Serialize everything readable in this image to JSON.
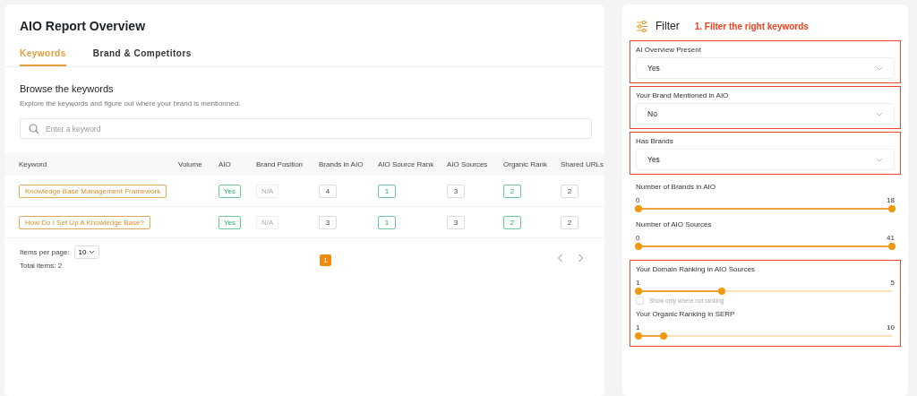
{
  "report": {
    "title": "AIO Report Overview",
    "tabs": [
      {
        "label": "Keywords",
        "selected": true
      },
      {
        "label": "Brand & Competitors",
        "selected": false
      }
    ],
    "section_title": "Browse the keywords",
    "section_description": "Explore the keywords and figure out where your brand is mentionned.",
    "search": {
      "placeholder": "Enter a keyword"
    },
    "table": {
      "columns": [
        "Keyword",
        "Volume",
        "AIO",
        "Brand Position",
        "Brands in AIO",
        "AIO Source Rank",
        "AIO Sources",
        "Organic Rank",
        "Shared URLs"
      ],
      "rows": [
        {
          "cells": [
            {
              "text": "Knowledge Base Management Framework",
              "kind": "keyword"
            },
            {
              "text": "",
              "kind": "empty"
            },
            {
              "text": "Yes",
              "kind": "positive"
            },
            {
              "text": "N/A",
              "kind": "muted"
            },
            {
              "text": "4",
              "kind": "neutral"
            },
            {
              "text": "1",
              "kind": "positive"
            },
            {
              "text": "3",
              "kind": "neutral"
            },
            {
              "text": "2",
              "kind": "positive"
            },
            {
              "text": "2",
              "kind": "neutral"
            }
          ]
        },
        {
          "cells": [
            {
              "text": "How Do I Set Up A Knowledge Base?",
              "kind": "keyword"
            },
            {
              "text": "",
              "kind": "empty"
            },
            {
              "text": "Yes",
              "kind": "positive"
            },
            {
              "text": "N/A",
              "kind": "muted"
            },
            {
              "text": "3",
              "kind": "neutral"
            },
            {
              "text": "1",
              "kind": "positive"
            },
            {
              "text": "3",
              "kind": "neutral"
            },
            {
              "text": "2",
              "kind": "positive"
            },
            {
              "text": "2",
              "kind": "neutral"
            }
          ]
        }
      ]
    },
    "pagination": {
      "items_per_page_label": "Items per page:",
      "items_per_page": "10",
      "total": "Total items: 2",
      "pages": [
        {
          "label": "1",
          "selected": true
        }
      ]
    }
  },
  "filter": {
    "title": "Filter",
    "annotation": "1. Filter the right keywords",
    "groups": [
      {
        "highlighted": true,
        "filters": [
          {
            "kind": "select",
            "label": "AI Overview Present",
            "value": "Yes"
          }
        ]
      },
      {
        "highlighted": true,
        "filters": [
          {
            "kind": "select",
            "label": "Your Brand Mentioned in AIO",
            "value": "No"
          }
        ]
      },
      {
        "highlighted": true,
        "filters": [
          {
            "kind": "select",
            "label": "Has Brands",
            "value": "Yes"
          }
        ]
      },
      {
        "highlighted": false,
        "filters": [
          {
            "kind": "range",
            "label": "Number of Brands in AIO",
            "min": "0",
            "max": "18",
            "level": 1
          },
          {
            "kind": "range",
            "label": "Number of AIO Sources",
            "min": "0",
            "max": "41",
            "level": 1
          }
        ]
      },
      {
        "highlighted": true,
        "filters": [
          {
            "kind": "range",
            "label": "Your Domain Ranking in AIO Sources",
            "min": "1",
            "max": "5",
            "level": 0.33,
            "checkbox": {
              "label": "Show only where not ranking",
              "checked": false
            }
          },
          {
            "kind": "range",
            "label": "Your Organic Ranking in SERP",
            "min": "1",
            "max": "10",
            "level": 0.1
          }
        ]
      }
    ]
  }
}
